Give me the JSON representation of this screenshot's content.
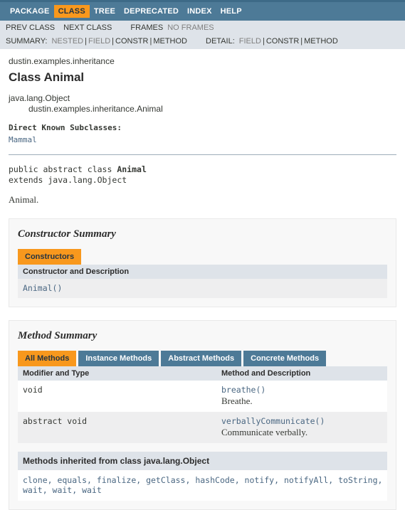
{
  "topnav": {
    "items": [
      {
        "label": "PACKAGE",
        "active": false
      },
      {
        "label": "CLASS",
        "active": true
      },
      {
        "label": "TREE",
        "active": false
      },
      {
        "label": "DEPRECATED",
        "active": false
      },
      {
        "label": "INDEX",
        "active": false
      },
      {
        "label": "HELP",
        "active": false
      }
    ]
  },
  "subnav": {
    "prev_class": "PREV CLASS",
    "next_class": "NEXT CLASS",
    "frames": "FRAMES",
    "no_frames": "NO FRAMES",
    "summary_label": "SUMMARY:",
    "summary_items": [
      "NESTED",
      "FIELD",
      "CONSTR",
      "METHOD"
    ],
    "detail_label": "DETAIL:",
    "detail_items": [
      "FIELD",
      "CONSTR",
      "METHOD"
    ]
  },
  "header": {
    "package": "dustin.examples.inheritance",
    "title": "Class Animal",
    "inheritance": [
      "java.lang.Object",
      "dustin.examples.inheritance.Animal"
    ],
    "subclasses_label": "Direct Known Subclasses:",
    "subclasses": "Mammal",
    "declaration_line1_prefix": "public abstract class ",
    "declaration_line1_name": "Animal",
    "declaration_line2": "extends java.lang.Object",
    "description": "Animal."
  },
  "constructor_summary": {
    "title": "Constructor Summary",
    "tab": "Constructors",
    "column_header": "Constructor and Description",
    "rows": [
      {
        "signature": "Animal()",
        "description": ""
      }
    ]
  },
  "method_summary": {
    "title": "Method Summary",
    "tabs": [
      {
        "label": "All Methods",
        "active": true
      },
      {
        "label": "Instance Methods",
        "active": false
      },
      {
        "label": "Abstract Methods",
        "active": false
      },
      {
        "label": "Concrete Methods",
        "active": false
      }
    ],
    "column_headers": [
      "Modifier and Type",
      "Method and Description"
    ],
    "rows": [
      {
        "modifier": "void",
        "signature": "breathe()",
        "description": "Breathe."
      },
      {
        "modifier": "abstract void",
        "signature": "verballyCommunicate()",
        "description": "Communicate verbally."
      }
    ]
  },
  "inherited": {
    "heading": "Methods inherited from class java.lang.Object",
    "methods": "clone, equals, finalize, getClass, hashCode, notify, notifyAll, toString, wait, wait, wait"
  },
  "colors": {
    "navbar": "#4D7A97",
    "accent": "#F8981D",
    "table_header": "#dee3e9",
    "link": "#4A6782"
  }
}
